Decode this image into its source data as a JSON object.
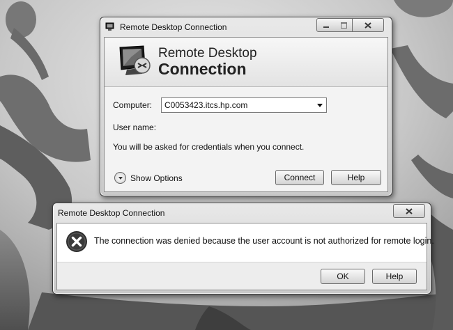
{
  "rdc_window": {
    "title": "Remote Desktop Connection",
    "banner_line1": "Remote Desktop",
    "banner_line2": "Connection",
    "computer_label": "Computer:",
    "computer_value": "C0053423.itcs.hp.com",
    "username_label": "User name:",
    "credentials_note": "You will be asked for credentials when you connect.",
    "show_options_label": "Show Options",
    "connect_label": "Connect",
    "help_label": "Help"
  },
  "error_dialog": {
    "title": "Remote Desktop Connection",
    "message": "The connection was denied because the user account is not authorized for remote login.",
    "ok_label": "OK",
    "help_label": "Help"
  },
  "icons": {
    "app_icon": "remote-desktop-icon",
    "error_icon": "error-x-icon",
    "show_options_icon": "chevron-down-icon"
  }
}
